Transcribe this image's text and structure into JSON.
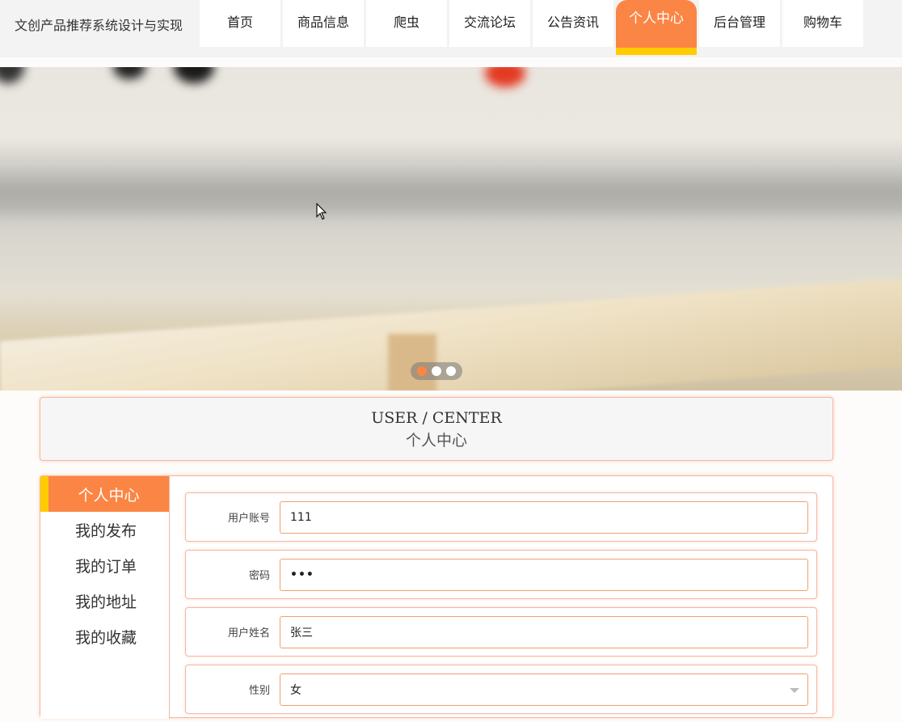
{
  "header": {
    "brand": "文创产品推荐系统设计与实现",
    "nav": [
      {
        "label": "首页"
      },
      {
        "label": "商品信息"
      },
      {
        "label": "爬虫"
      },
      {
        "label": "交流论坛"
      },
      {
        "label": "公告资讯"
      },
      {
        "label": "个人中心",
        "active": true
      },
      {
        "label": "后台管理"
      },
      {
        "label": "购物车"
      }
    ]
  },
  "banner": {
    "dots": 3,
    "active_dot": 0
  },
  "section": {
    "title_en": "USER / CENTER",
    "title_cn": "个人中心"
  },
  "sidebar": {
    "head": "个人中心",
    "items": [
      {
        "label": "我的发布"
      },
      {
        "label": "我的订单"
      },
      {
        "label": "我的地址"
      },
      {
        "label": "我的收藏"
      }
    ]
  },
  "form": {
    "account_label": "用户账号",
    "account_value": "111",
    "password_label": "密码",
    "password_value": "•••",
    "name_label": "用户姓名",
    "name_value": "张三",
    "gender_label": "性别",
    "gender_value": "女"
  },
  "colors": {
    "accent": "#fb8544",
    "accent_bar": "#ffcc00"
  }
}
